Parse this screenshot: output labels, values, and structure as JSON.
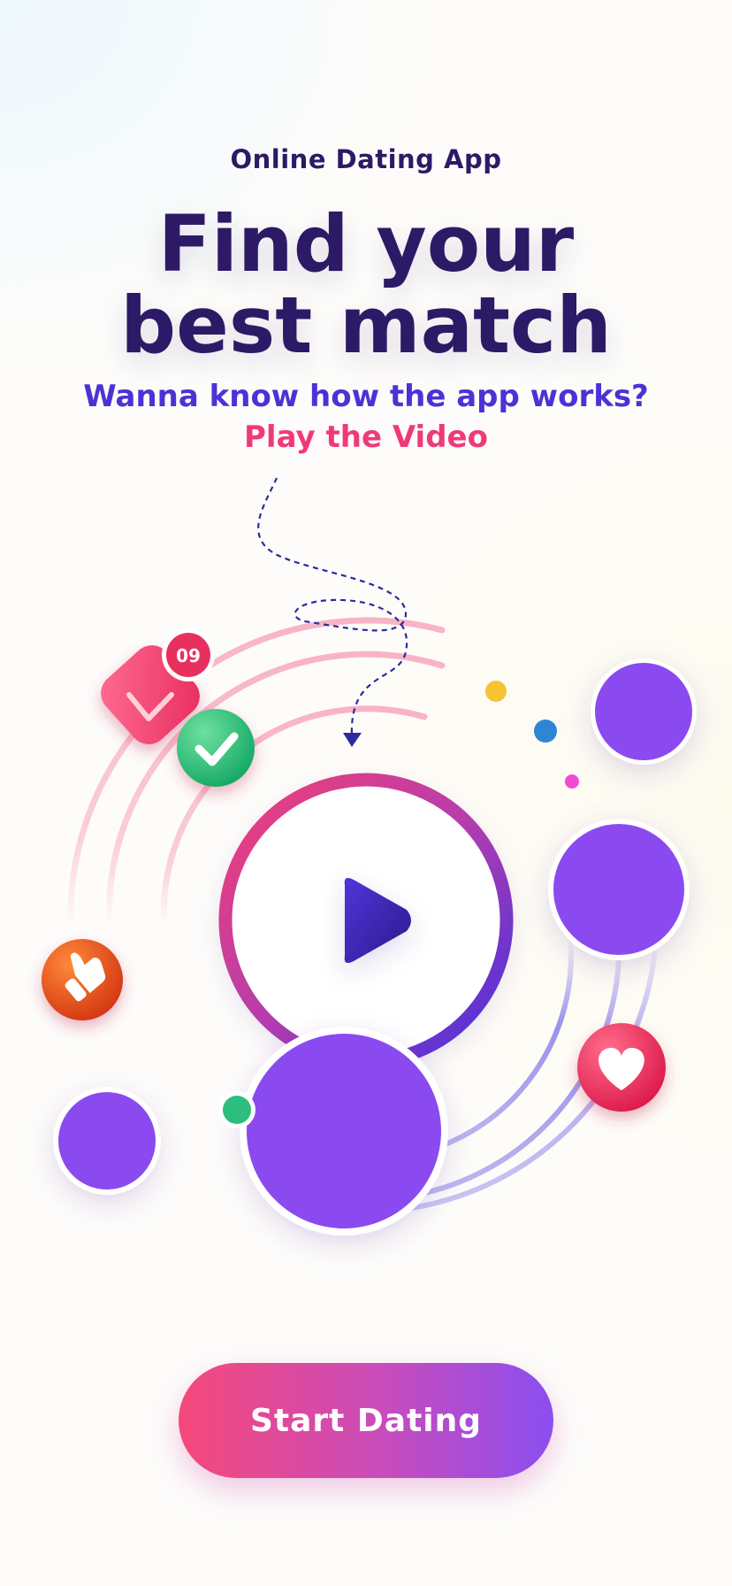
{
  "hero": {
    "eyebrow": "Online Dating App",
    "headline_line1": "Find your",
    "headline_line2": "best match",
    "question": "Wanna know how the app works?",
    "video_link": "Play the Video"
  },
  "illustration": {
    "message_badge_count": "09",
    "icons": [
      "mail-icon",
      "check-icon",
      "play-icon",
      "like-hand-icon",
      "heart-icon"
    ]
  },
  "cta": {
    "label": "Start Dating"
  },
  "colors": {
    "title": "#2d1a66",
    "question": "#4a33d6",
    "link": "#f03a78",
    "avatar": "#8b4af0",
    "button_start": "#f5487a",
    "button_end": "#8b4ef0"
  }
}
